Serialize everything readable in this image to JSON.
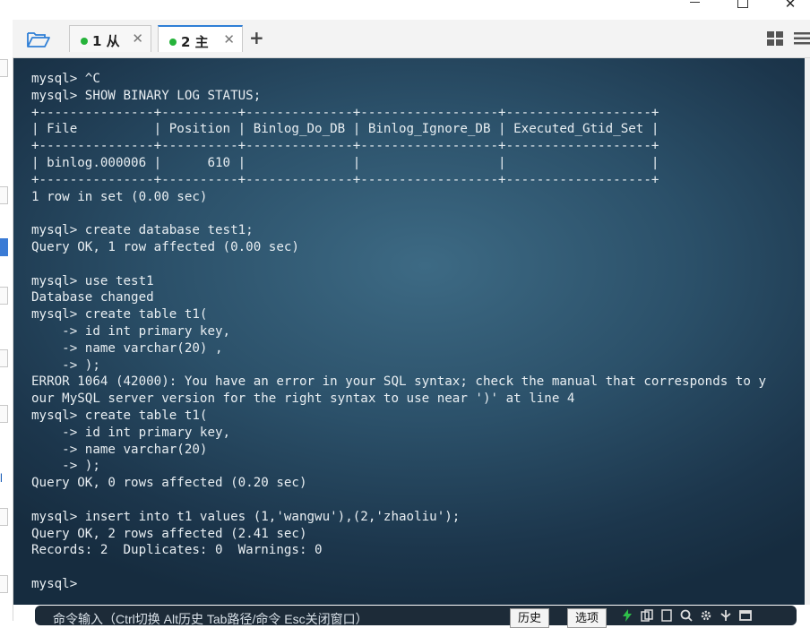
{
  "window": {
    "min_icon": "minimize-icon",
    "max_icon": "maximize-icon",
    "close_glyph": "✕"
  },
  "tabs": [
    {
      "label": "1 从",
      "status_color": "#25b33a",
      "close": "✕"
    },
    {
      "label": "2 主",
      "status_color": "#25b33a",
      "close": "✕",
      "active": true
    }
  ],
  "toolbar": {
    "new_tab": "+",
    "open_icon": "folder-open-icon",
    "layout_icon": "grid-icon",
    "menu_icon": "menu-icon"
  },
  "terminal": {
    "text": "mysql> ^C\nmysql> SHOW BINARY LOG STATUS;\n+---------------+----------+--------------+------------------+-------------------+\n| File          | Position | Binlog_Do_DB | Binlog_Ignore_DB | Executed_Gtid_Set |\n+---------------+----------+--------------+------------------+-------------------+\n| binlog.000006 |      610 |              |                  |                   |\n+---------------+----------+--------------+------------------+-------------------+\n1 row in set (0.00 sec)\n\nmysql> create database test1;\nQuery OK, 1 row affected (0.00 sec)\n\nmysql> use test1\nDatabase changed\nmysql> create table t1(\n    -> id int primary key,\n    -> name varchar(20) ,\n    -> );\nERROR 1064 (42000): You have an error in your SQL syntax; check the manual that corresponds to y\nour MySQL server version for the right syntax to use near ')' at line 4\nmysql> create table t1(\n    -> id int primary key,\n    -> name varchar(20)\n    -> );\nQuery OK, 0 rows affected (0.20 sec)\n\nmysql> insert into t1 values (1,'wangwu'),(2,'zhaoliu');\nQuery OK, 2 rows affected (2.41 sec)\nRecords: 2  Duplicates: 0  Warnings: 0\n\nmysql>"
  },
  "command_bar": {
    "placeholder": "命令输入（Ctrl切换 Alt历史 Tab路径/命令 Esc关闭窗口）",
    "history_button": "历史",
    "options_button": "选项"
  },
  "left_strip": {
    "label": "l"
  }
}
